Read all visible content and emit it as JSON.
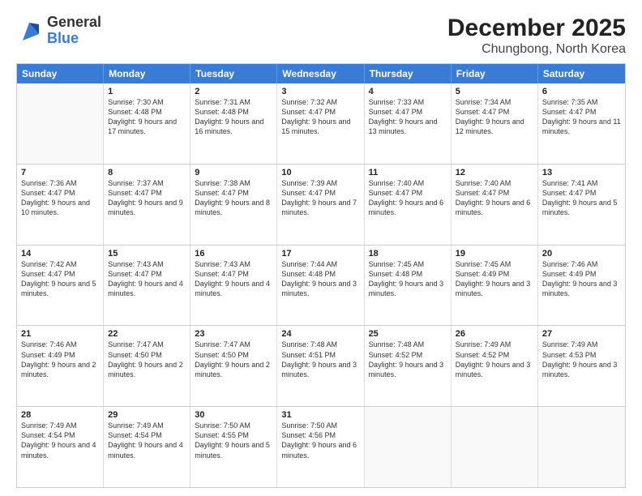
{
  "header": {
    "logo": {
      "general": "General",
      "blue": "Blue"
    },
    "month_year": "December 2025",
    "location": "Chungbong, North Korea"
  },
  "days_of_week": [
    "Sunday",
    "Monday",
    "Tuesday",
    "Wednesday",
    "Thursday",
    "Friday",
    "Saturday"
  ],
  "weeks": [
    [
      {
        "day": "",
        "sunrise": "",
        "sunset": "",
        "daylight": ""
      },
      {
        "day": "1",
        "sunrise": "Sunrise: 7:30 AM",
        "sunset": "Sunset: 4:48 PM",
        "daylight": "Daylight: 9 hours and 17 minutes."
      },
      {
        "day": "2",
        "sunrise": "Sunrise: 7:31 AM",
        "sunset": "Sunset: 4:48 PM",
        "daylight": "Daylight: 9 hours and 16 minutes."
      },
      {
        "day": "3",
        "sunrise": "Sunrise: 7:32 AM",
        "sunset": "Sunset: 4:47 PM",
        "daylight": "Daylight: 9 hours and 15 minutes."
      },
      {
        "day": "4",
        "sunrise": "Sunrise: 7:33 AM",
        "sunset": "Sunset: 4:47 PM",
        "daylight": "Daylight: 9 hours and 13 minutes."
      },
      {
        "day": "5",
        "sunrise": "Sunrise: 7:34 AM",
        "sunset": "Sunset: 4:47 PM",
        "daylight": "Daylight: 9 hours and 12 minutes."
      },
      {
        "day": "6",
        "sunrise": "Sunrise: 7:35 AM",
        "sunset": "Sunset: 4:47 PM",
        "daylight": "Daylight: 9 hours and 11 minutes."
      }
    ],
    [
      {
        "day": "7",
        "sunrise": "Sunrise: 7:36 AM",
        "sunset": "Sunset: 4:47 PM",
        "daylight": "Daylight: 9 hours and 10 minutes."
      },
      {
        "day": "8",
        "sunrise": "Sunrise: 7:37 AM",
        "sunset": "Sunset: 4:47 PM",
        "daylight": "Daylight: 9 hours and 9 minutes."
      },
      {
        "day": "9",
        "sunrise": "Sunrise: 7:38 AM",
        "sunset": "Sunset: 4:47 PM",
        "daylight": "Daylight: 9 hours and 8 minutes."
      },
      {
        "day": "10",
        "sunrise": "Sunrise: 7:39 AM",
        "sunset": "Sunset: 4:47 PM",
        "daylight": "Daylight: 9 hours and 7 minutes."
      },
      {
        "day": "11",
        "sunrise": "Sunrise: 7:40 AM",
        "sunset": "Sunset: 4:47 PM",
        "daylight": "Daylight: 9 hours and 6 minutes."
      },
      {
        "day": "12",
        "sunrise": "Sunrise: 7:40 AM",
        "sunset": "Sunset: 4:47 PM",
        "daylight": "Daylight: 9 hours and 6 minutes."
      },
      {
        "day": "13",
        "sunrise": "Sunrise: 7:41 AM",
        "sunset": "Sunset: 4:47 PM",
        "daylight": "Daylight: 9 hours and 5 minutes."
      }
    ],
    [
      {
        "day": "14",
        "sunrise": "Sunrise: 7:42 AM",
        "sunset": "Sunset: 4:47 PM",
        "daylight": "Daylight: 9 hours and 5 minutes."
      },
      {
        "day": "15",
        "sunrise": "Sunrise: 7:43 AM",
        "sunset": "Sunset: 4:47 PM",
        "daylight": "Daylight: 9 hours and 4 minutes."
      },
      {
        "day": "16",
        "sunrise": "Sunrise: 7:43 AM",
        "sunset": "Sunset: 4:47 PM",
        "daylight": "Daylight: 9 hours and 4 minutes."
      },
      {
        "day": "17",
        "sunrise": "Sunrise: 7:44 AM",
        "sunset": "Sunset: 4:48 PM",
        "daylight": "Daylight: 9 hours and 3 minutes."
      },
      {
        "day": "18",
        "sunrise": "Sunrise: 7:45 AM",
        "sunset": "Sunset: 4:48 PM",
        "daylight": "Daylight: 9 hours and 3 minutes."
      },
      {
        "day": "19",
        "sunrise": "Sunrise: 7:45 AM",
        "sunset": "Sunset: 4:49 PM",
        "daylight": "Daylight: 9 hours and 3 minutes."
      },
      {
        "day": "20",
        "sunrise": "Sunrise: 7:46 AM",
        "sunset": "Sunset: 4:49 PM",
        "daylight": "Daylight: 9 hours and 3 minutes."
      }
    ],
    [
      {
        "day": "21",
        "sunrise": "Sunrise: 7:46 AM",
        "sunset": "Sunset: 4:49 PM",
        "daylight": "Daylight: 9 hours and 2 minutes."
      },
      {
        "day": "22",
        "sunrise": "Sunrise: 7:47 AM",
        "sunset": "Sunset: 4:50 PM",
        "daylight": "Daylight: 9 hours and 2 minutes."
      },
      {
        "day": "23",
        "sunrise": "Sunrise: 7:47 AM",
        "sunset": "Sunset: 4:50 PM",
        "daylight": "Daylight: 9 hours and 2 minutes."
      },
      {
        "day": "24",
        "sunrise": "Sunrise: 7:48 AM",
        "sunset": "Sunset: 4:51 PM",
        "daylight": "Daylight: 9 hours and 3 minutes."
      },
      {
        "day": "25",
        "sunrise": "Sunrise: 7:48 AM",
        "sunset": "Sunset: 4:52 PM",
        "daylight": "Daylight: 9 hours and 3 minutes."
      },
      {
        "day": "26",
        "sunrise": "Sunrise: 7:49 AM",
        "sunset": "Sunset: 4:52 PM",
        "daylight": "Daylight: 9 hours and 3 minutes."
      },
      {
        "day": "27",
        "sunrise": "Sunrise: 7:49 AM",
        "sunset": "Sunset: 4:53 PM",
        "daylight": "Daylight: 9 hours and 3 minutes."
      }
    ],
    [
      {
        "day": "28",
        "sunrise": "Sunrise: 7:49 AM",
        "sunset": "Sunset: 4:54 PM",
        "daylight": "Daylight: 9 hours and 4 minutes."
      },
      {
        "day": "29",
        "sunrise": "Sunrise: 7:49 AM",
        "sunset": "Sunset: 4:54 PM",
        "daylight": "Daylight: 9 hours and 4 minutes."
      },
      {
        "day": "30",
        "sunrise": "Sunrise: 7:50 AM",
        "sunset": "Sunset: 4:55 PM",
        "daylight": "Daylight: 9 hours and 5 minutes."
      },
      {
        "day": "31",
        "sunrise": "Sunrise: 7:50 AM",
        "sunset": "Sunset: 4:56 PM",
        "daylight": "Daylight: 9 hours and 6 minutes."
      },
      {
        "day": "",
        "sunrise": "",
        "sunset": "",
        "daylight": ""
      },
      {
        "day": "",
        "sunrise": "",
        "sunset": "",
        "daylight": ""
      },
      {
        "day": "",
        "sunrise": "",
        "sunset": "",
        "daylight": ""
      }
    ]
  ]
}
